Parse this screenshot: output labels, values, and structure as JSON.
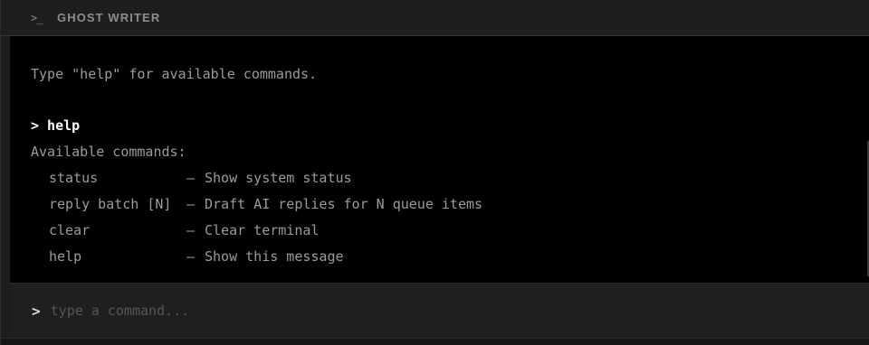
{
  "header": {
    "icon": "terminal-prompt-icon",
    "icon_glyph": ">_",
    "title": "GHOST WRITER"
  },
  "terminal": {
    "intro": "Type \"help\" for available commands.",
    "entered_command": "> help",
    "commands_heading": "Available commands:",
    "commands": [
      {
        "name": "status",
        "desc": "Show system status"
      },
      {
        "name": "reply batch [N]",
        "desc": "Draft AI replies for N queue items"
      },
      {
        "name": "clear",
        "desc": "Clear terminal"
      },
      {
        "name": "help",
        "desc": "Show this message"
      }
    ],
    "dash": "—"
  },
  "input": {
    "prompt": ">",
    "placeholder": "type a command...",
    "value": ""
  }
}
